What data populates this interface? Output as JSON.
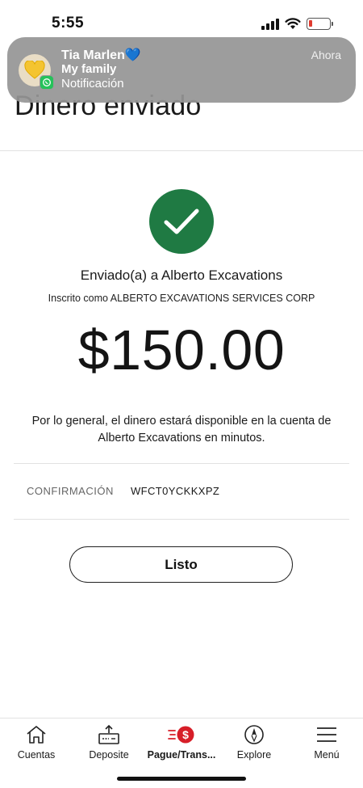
{
  "status_bar": {
    "time": "5:55"
  },
  "notification": {
    "title": "Tia Marlen💙",
    "subtitle": "My family",
    "body": "Notificación",
    "time": "Ahora",
    "avatar_icon": "yellow-heart-icon",
    "app_icon": "whatsapp-icon"
  },
  "page": {
    "title": "Dinero enviado"
  },
  "confirmation": {
    "sent_to": "Enviado(a) a Alberto Excavations",
    "registered_as": "Inscrito como ALBERTO EXCAVATIONS SERVICES CORP",
    "amount": "$150.00",
    "availability_message": "Por lo general, el dinero estará disponible en la cuenta de Alberto Excavations en minutos.",
    "confirmation_label": "CONFIRMACIÓN",
    "confirmation_code": "WFCT0YCKKXPZ",
    "done_label": "Listo"
  },
  "bottom_nav": {
    "items": [
      {
        "label": "Cuentas",
        "icon": "home-icon",
        "active": false
      },
      {
        "label": "Deposite",
        "icon": "deposit-icon",
        "active": false
      },
      {
        "label": "Pague/Trans...",
        "icon": "pay-transfer-icon",
        "active": true
      },
      {
        "label": "Explore",
        "icon": "compass-icon",
        "active": false
      },
      {
        "label": "Menú",
        "icon": "menu-icon",
        "active": false
      }
    ]
  },
  "colors": {
    "success_green": "#1f7a43",
    "pay_badge_red": "#d71e28",
    "whatsapp_green": "#25c25a"
  }
}
